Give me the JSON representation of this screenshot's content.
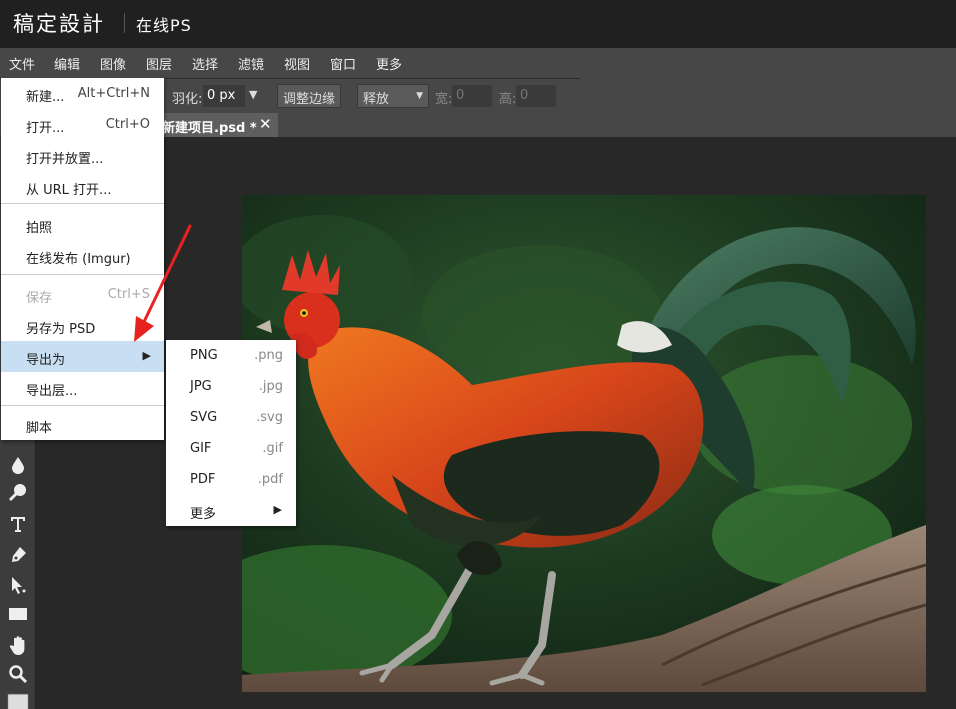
{
  "header": {
    "brand": "稿定設計",
    "subtitle": "在线PS"
  },
  "menubar": [
    "文件",
    "编辑",
    "图像",
    "图层",
    "选择",
    "滤镜",
    "视图",
    "窗口",
    "更多"
  ],
  "toolbar": {
    "feather_label": "羽化:",
    "feather_value": "0  px",
    "refine_edge": "调整边缘",
    "mode": "释放",
    "width_label": "宽:",
    "width_value": "0",
    "height_label": "高:",
    "height_value": "0"
  },
  "tab": {
    "title": "新建项目.psd *",
    "close": "✕"
  },
  "file_menu": {
    "new": {
      "label": "新建...",
      "shortcut": "Alt+Ctrl+N"
    },
    "open": {
      "label": "打开...",
      "shortcut": "Ctrl+O"
    },
    "open_place": {
      "label": "打开并放置..."
    },
    "open_url": {
      "label": "从 URL 打开..."
    },
    "photo": {
      "label": "拍照"
    },
    "publish": {
      "label": "在线发布 (Imgur)"
    },
    "save": {
      "label": "保存",
      "shortcut": "Ctrl+S"
    },
    "save_as_psd": {
      "label": "另存为 PSD"
    },
    "export_as": {
      "label": "导出为",
      "arrow": "▶"
    },
    "export_layers": {
      "label": "导出层..."
    },
    "script": {
      "label": "脚本"
    }
  },
  "export_submenu": {
    "png": {
      "label": "PNG",
      "ext": ".png"
    },
    "jpg": {
      "label": "JPG",
      "ext": ".jpg"
    },
    "svg": {
      "label": "SVG",
      "ext": ".svg"
    },
    "gif": {
      "label": "GIF",
      "ext": ".gif"
    },
    "pdf": {
      "label": "PDF",
      "ext": ".pdf"
    },
    "more": {
      "label": "更多",
      "arrow": "▶"
    }
  },
  "colors": {
    "menu_active": "#c8dff3",
    "annotation_arrow": "#e8231f",
    "chrome": "#474747"
  },
  "icons": [
    "drop-icon",
    "smudge-icon",
    "text-icon",
    "pen-icon",
    "select-arrow-icon",
    "rectangle-icon",
    "hand-icon",
    "zoom-icon",
    "color-swatch-icon"
  ]
}
